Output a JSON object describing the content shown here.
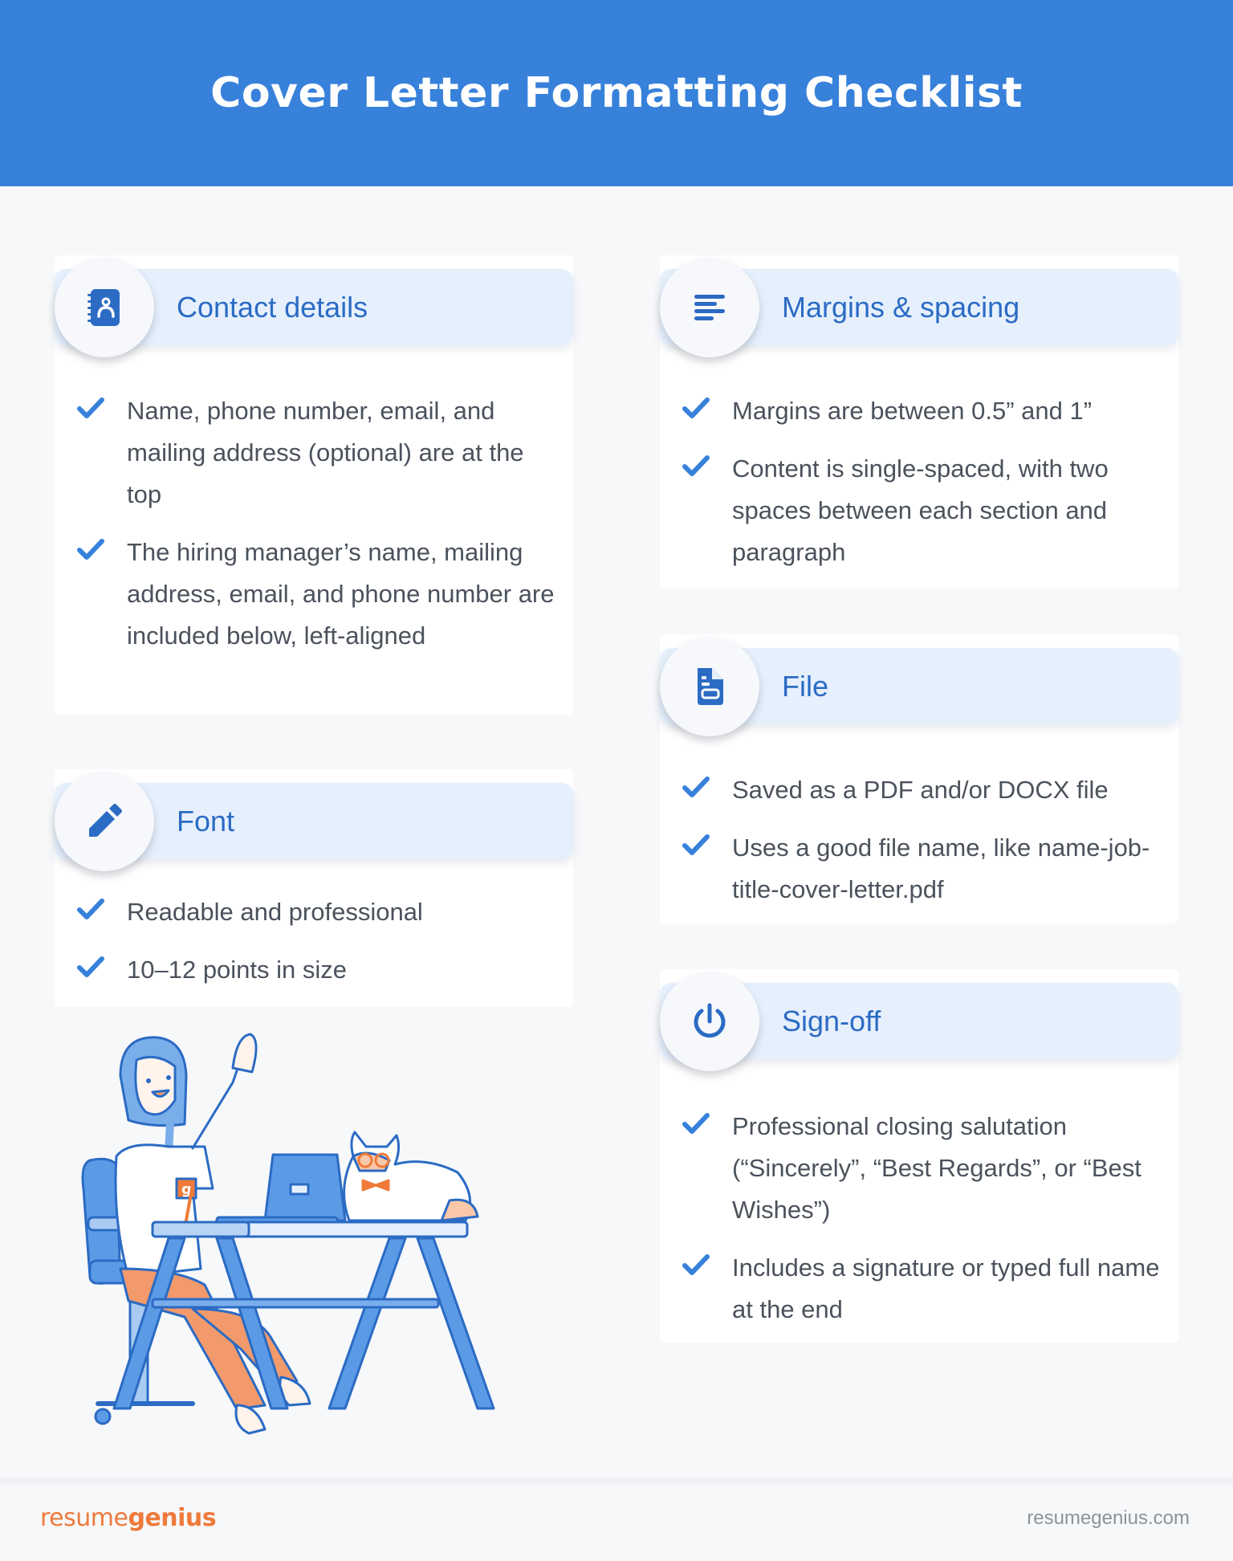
{
  "header": {
    "title": "Cover Letter Formatting Checklist"
  },
  "colors": {
    "header_bg": "#3781DB",
    "accent": "#2B6BC4",
    "check": "#3781DB",
    "section_header_bg": "#E6F0FD",
    "body_text": "#4B525C",
    "brand_orange": "#EF7A3A",
    "page_bg": "#F7F8FA"
  },
  "sections": [
    {
      "title": "Contact details",
      "icon": "contact-book-icon",
      "items": [
        "Name, phone number, email, and mailing address (optional) are at the top",
        "The hiring manager’s name, mailing address, email, and phone number are included below, left-aligned"
      ]
    },
    {
      "title": "Font",
      "icon": "pencil-icon",
      "items": [
        "Readable and professional",
        "10–12 points in size"
      ]
    },
    {
      "title": "Margins & spacing",
      "icon": "align-left-icon",
      "items": [
        "Margins are between 0.5” and 1”",
        "Content is single-spaced, with two spaces between each section and paragraph"
      ]
    },
    {
      "title": "File",
      "icon": "file-icon",
      "items": [
        "Saved as a PDF and/or DOCX file",
        "Uses a good file name, like name-job-title-cover-letter.pdf"
      ]
    },
    {
      "title": "Sign-off",
      "icon": "power-icon",
      "items": [
        "Professional closing salutation (“Sincerely”, “Best Regards”, or “Best Wishes”)",
        "Includes a signature or typed full name at the end"
      ]
    }
  ],
  "illustration": {
    "badge_letter": "g"
  },
  "footer": {
    "brand_light": "resume",
    "brand_bold": "genius",
    "site": "resumegenius.com"
  }
}
